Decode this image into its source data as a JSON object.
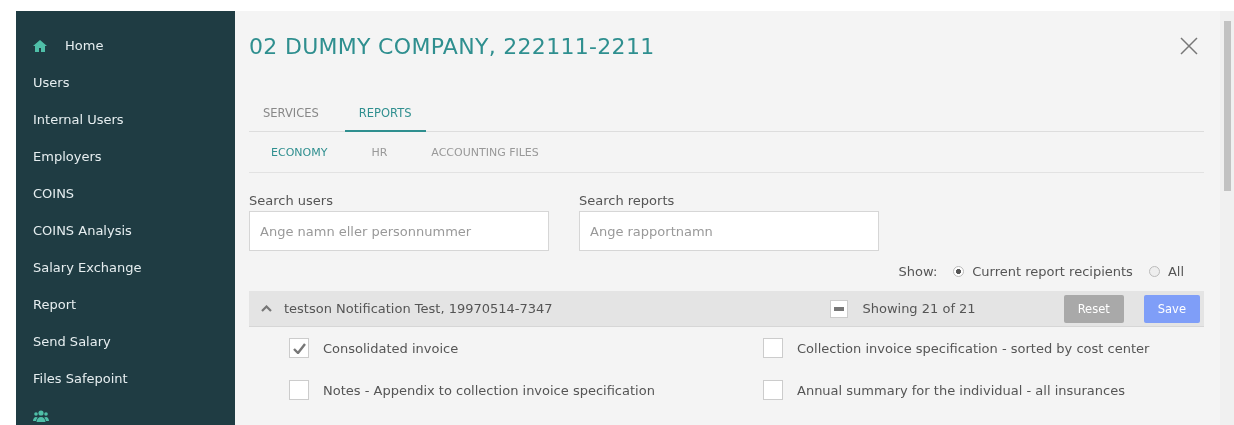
{
  "sidebar": {
    "items": [
      {
        "label": "Home",
        "kind": "home"
      },
      {
        "label": "Users",
        "kind": "text"
      },
      {
        "label": "Internal Users",
        "kind": "text"
      },
      {
        "label": "Employers",
        "kind": "text"
      },
      {
        "label": "COINS",
        "kind": "text"
      },
      {
        "label": "COINS Analysis",
        "kind": "text"
      },
      {
        "label": "Salary Exchange",
        "kind": "text"
      },
      {
        "label": "Report",
        "kind": "text"
      },
      {
        "label": "Send Salary",
        "kind": "text"
      },
      {
        "label": "Files Safepoint",
        "kind": "text"
      },
      {
        "kind": "group"
      }
    ]
  },
  "dialog": {
    "title": "02 DUMMY COMPANY, 222111-2211",
    "tabs": [
      {
        "label": "SERVICES",
        "selected": false
      },
      {
        "label": "REPORTS",
        "selected": true
      }
    ],
    "subtabs": [
      {
        "label": "ECONOMY",
        "selected": true
      },
      {
        "label": "HR",
        "selected": false
      },
      {
        "label": "ACCOUNTING FILES",
        "selected": false
      }
    ],
    "search_users": {
      "label": "Search users",
      "placeholder": "Ange namn eller personnummer"
    },
    "search_reports": {
      "label": "Search reports",
      "placeholder": "Ange rapportnamn"
    },
    "show": {
      "label": "Show:",
      "options": [
        {
          "label": "Current report recipients",
          "selected": true
        },
        {
          "label": "All",
          "selected": false
        }
      ]
    },
    "group": {
      "title": "testson Notification Test, 19970514-7347",
      "expanded": true,
      "indeterminate": true,
      "count": "Showing 21 of 21",
      "reset": "Reset",
      "save": "Save",
      "reports": [
        {
          "label": "Consolidated invoice",
          "checked": true
        },
        {
          "label": "Collection invoice specification - sorted by cost center",
          "checked": false
        },
        {
          "label": "Notes - Appendix to collection invoice specification",
          "checked": false
        },
        {
          "label": "Annual summary for the individual - all insurances",
          "checked": false
        }
      ]
    }
  }
}
